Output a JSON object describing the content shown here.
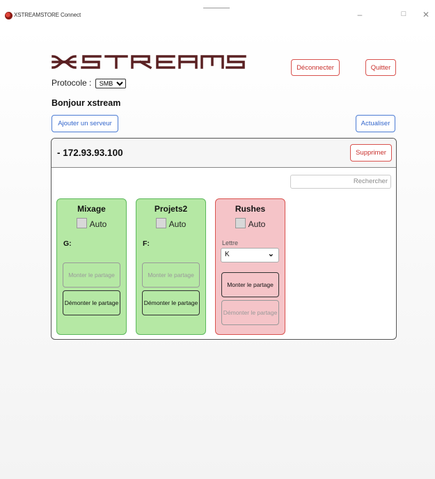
{
  "window": {
    "title": "XSTREAMSTORE Connect",
    "minimize": "–",
    "maximize": "□",
    "close": "✕"
  },
  "logo": {
    "text": "XSTREAMSTORE",
    "color": "#5a2022"
  },
  "header": {
    "disconnect_label": "Déconnecter",
    "quit_label": "Quitter"
  },
  "protocol": {
    "label": "Protocole :",
    "selected": "SMB"
  },
  "greeting": "Bonjour xstream",
  "toolbar": {
    "add_server_label": "Ajouter un serveur",
    "refresh_label": "Actualiser"
  },
  "server": {
    "title": "- 172.93.93.100",
    "delete_label": "Supprimer",
    "search_placeholder": "Rechercher",
    "shares": [
      {
        "name": "Mixage",
        "auto_label": "Auto",
        "auto_checked": false,
        "drive": "G:",
        "mount_label": "Monter le partage",
        "mount_enabled": false,
        "unmount_label": "Démonter le partage",
        "unmount_enabled": true,
        "color": "#b5e8a4"
      },
      {
        "name": "Projets2",
        "auto_label": "Auto",
        "auto_checked": false,
        "drive": "F:",
        "mount_label": "Monter le partage",
        "mount_enabled": false,
        "unmount_label": "Démonter le partage",
        "unmount_enabled": true,
        "color": "#b5e8a4"
      },
      {
        "name": "Rushes",
        "auto_label": "Auto",
        "auto_checked": false,
        "letter_label": "Lettre",
        "letter_selected": "K",
        "mount_label": "Monter le partage",
        "mount_enabled": true,
        "unmount_label": "Démonter le partage",
        "unmount_enabled": false,
        "color": "#f5c4c8"
      }
    ]
  }
}
